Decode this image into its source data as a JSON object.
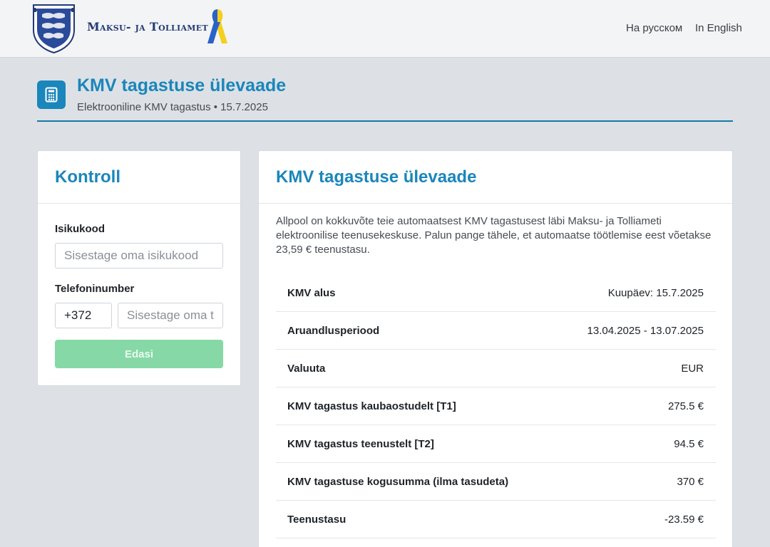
{
  "header": {
    "logo_text": "Maksu- ja Tolliamet",
    "lang_ru": "На русском",
    "lang_en": "In English"
  },
  "page": {
    "title": "KMV tagastuse ülevaade",
    "subtitle": "Elektrooniline KMV tagastus • 15.7.2025",
    "icon": "calculator-icon"
  },
  "control": {
    "title": "Kontroll",
    "id_label": "Isikukood",
    "id_placeholder": "Sisestage oma isikukood",
    "phone_label": "Telefoninumber",
    "phone_prefix": "+372",
    "phone_placeholder": "Sisestage oma telefoninumber",
    "next_label": "Edasi"
  },
  "overview": {
    "title": "KMV tagastuse ülevaade",
    "intro": "Allpool on kokkuvõte teie automaatsest KMV tagastusest läbi Maksu- ja Tolliameti elektroonilise teenusekeskuse. Palun pange tähele, et automaatse töötlemise eest võetakse 23,59 € teenustasu.",
    "rows": [
      {
        "label": "KMV alus",
        "value": "Kuupäev: 15.7.2025"
      },
      {
        "label": "Aruandlusperiood",
        "value": "13.04.2025 - 13.07.2025"
      },
      {
        "label": "Valuuta",
        "value": "EUR"
      },
      {
        "label": "KMV tagastus kaubaostudelt [T1]",
        "value": "275.5 €"
      },
      {
        "label": "KMV tagastus teenustelt [T2]",
        "value": "94.5 €"
      },
      {
        "label": "KMV tagastuse kogusumma (ilma tasudeta)",
        "value": "370 €"
      },
      {
        "label": "Teenustasu",
        "value": "-23.59 €"
      }
    ]
  },
  "colors": {
    "accent": "#1a86bb",
    "button_disabled": "#86d9a6",
    "background": "#dde1e5"
  }
}
